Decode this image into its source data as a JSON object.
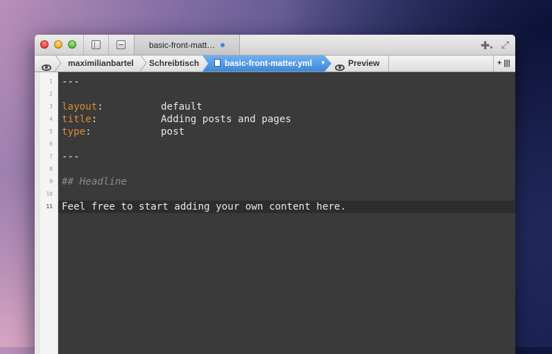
{
  "window": {
    "tab_title": "basic-front-matt…",
    "colors": {
      "accent": "#3d87d6",
      "editor_bg": "#3a3a3a",
      "key": "#e08a30"
    }
  },
  "breadcrumb": {
    "items": [
      "maximilianbartel",
      "Schreibtisch",
      "basic-front-matter.yml"
    ],
    "preview_label": "Preview",
    "add_label": "+ |||"
  },
  "editor": {
    "line_numbers": [
      "1",
      "2",
      "3",
      "4",
      "5",
      "6",
      "7",
      "8",
      "9",
      "10",
      "11"
    ],
    "lines": {
      "l1": "---",
      "l3_key": "layout",
      "l3_val": "default",
      "l4_key": "title",
      "l4_val": "Adding posts and pages",
      "l5_key": "type",
      "l5_val": "post",
      "l7": "---",
      "l9": "## Headline",
      "l11": "Feel free to start adding your own content here."
    },
    "colon": ":",
    "current_line": 11
  }
}
